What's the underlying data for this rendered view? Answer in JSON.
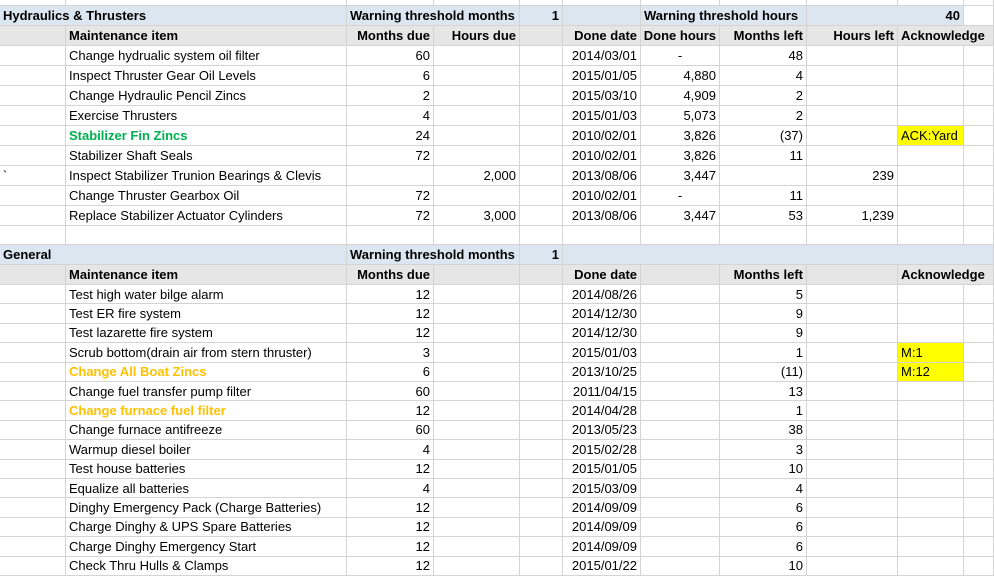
{
  "sections": [
    {
      "title": "Hydraulics & Thrusters",
      "params": [
        {
          "label": "Warning threshold months",
          "value": "1"
        },
        {
          "label": "Warning threshold hours",
          "value": "40"
        }
      ],
      "headers": {
        "item": "Maintenance item",
        "months_due": "Months due",
        "hours_due": "Hours due",
        "done_date": "Done date",
        "done_hours": "Done hours",
        "months_left": "Months left",
        "hours_left": "Hours left",
        "ack": "Acknowledge"
      },
      "rows": [
        {
          "marker": "",
          "item": "Change hydrualic system oil filter",
          "months_due": "60",
          "hours_due": "",
          "done_date": "2014/03/01",
          "done_hours": "-",
          "months_left": "48",
          "hours_left": "",
          "ack": "",
          "style": ""
        },
        {
          "marker": "",
          "item": "Inspect Thruster Gear Oil Levels",
          "months_due": "6",
          "hours_due": "",
          "done_date": "2015/01/05",
          "done_hours": "4,880",
          "months_left": "4",
          "hours_left": "",
          "ack": "",
          "style": ""
        },
        {
          "marker": "",
          "item": "Change Hydraulic Pencil Zincs",
          "months_due": "2",
          "hours_due": "",
          "done_date": "2015/03/10",
          "done_hours": "4,909",
          "months_left": "2",
          "hours_left": "",
          "ack": "",
          "style": ""
        },
        {
          "marker": "",
          "item": "Exercise Thrusters",
          "months_due": "4",
          "hours_due": "",
          "done_date": "2015/01/03",
          "done_hours": "5,073",
          "months_left": "2",
          "hours_left": "",
          "ack": "",
          "style": ""
        },
        {
          "marker": "",
          "item": "Stabilizer Fin Zincs",
          "months_due": "24",
          "hours_due": "",
          "done_date": "2010/02/01",
          "done_hours": "3,826",
          "months_left": "(37)",
          "hours_left": "",
          "ack": "ACK:Yard",
          "style": "green"
        },
        {
          "marker": "",
          "item": "Stabilizer Shaft Seals",
          "months_due": "72",
          "hours_due": "",
          "done_date": "2010/02/01",
          "done_hours": "3,826",
          "months_left": "11",
          "hours_left": "",
          "ack": "",
          "style": ""
        },
        {
          "marker": "`",
          "item": "Inspect Stabilizer Trunion Bearings & Clevis",
          "months_due": "",
          "hours_due": "2,000",
          "done_date": "2013/08/06",
          "done_hours": "3,447",
          "months_left": "",
          "hours_left": "239",
          "ack": "",
          "style": ""
        },
        {
          "marker": "",
          "item": "Change Thruster Gearbox Oil",
          "months_due": "72",
          "hours_due": "",
          "done_date": "2010/02/01",
          "done_hours": "-",
          "months_left": "11",
          "hours_left": "",
          "ack": "",
          "style": ""
        },
        {
          "marker": "",
          "item": "Replace Stabilizer Actuator Cylinders",
          "months_due": "72",
          "hours_due": "3,000",
          "done_date": "2013/08/06",
          "done_hours": "3,447",
          "months_left": "53",
          "hours_left": "1,239",
          "ack": "",
          "style": ""
        }
      ]
    },
    {
      "title": "General",
      "params": [
        {
          "label": "Warning threshold months",
          "value": "1"
        }
      ],
      "headers": {
        "item": "Maintenance item",
        "months_due": "Months due",
        "hours_due": "",
        "done_date": "Done date",
        "done_hours": "",
        "months_left": "Months left",
        "hours_left": "",
        "ack": "Acknowledge"
      },
      "rows": [
        {
          "marker": "",
          "item": "Test high water bilge alarm",
          "months_due": "12",
          "hours_due": "",
          "done_date": "2014/08/26",
          "done_hours": "",
          "months_left": "5",
          "hours_left": "",
          "ack": "",
          "style": ""
        },
        {
          "marker": "",
          "item": "Test ER fire system",
          "months_due": "12",
          "hours_due": "",
          "done_date": "2014/12/30",
          "done_hours": "",
          "months_left": "9",
          "hours_left": "",
          "ack": "",
          "style": ""
        },
        {
          "marker": "",
          "item": "Test lazarette fire system",
          "months_due": "12",
          "hours_due": "",
          "done_date": "2014/12/30",
          "done_hours": "",
          "months_left": "9",
          "hours_left": "",
          "ack": "",
          "style": ""
        },
        {
          "marker": "",
          "item": "Scrub bottom(drain air from stern thruster)",
          "months_due": "3",
          "hours_due": "",
          "done_date": "2015/01/03",
          "done_hours": "",
          "months_left": "1",
          "hours_left": "",
          "ack": "M:1",
          "style": ""
        },
        {
          "marker": "",
          "item": "Change All Boat Zincs",
          "months_due": "6",
          "hours_due": "",
          "done_date": "2013/10/25",
          "done_hours": "",
          "months_left": "(11)",
          "hours_left": "",
          "ack": "M:12",
          "style": "orange"
        },
        {
          "marker": "",
          "item": "Change fuel transfer pump filter",
          "months_due": "60",
          "hours_due": "",
          "done_date": "2011/04/15",
          "done_hours": "",
          "months_left": "13",
          "hours_left": "",
          "ack": "",
          "style": ""
        },
        {
          "marker": "",
          "item": "Change furnace fuel filter",
          "months_due": "12",
          "hours_due": "",
          "done_date": "2014/04/28",
          "done_hours": "",
          "months_left": "1",
          "hours_left": "",
          "ack": "",
          "style": "orange"
        },
        {
          "marker": "",
          "item": "Change furnace antifreeze",
          "months_due": "60",
          "hours_due": "",
          "done_date": "2013/05/23",
          "done_hours": "",
          "months_left": "38",
          "hours_left": "",
          "ack": "",
          "style": ""
        },
        {
          "marker": "",
          "item": "Warmup diesel boiler",
          "months_due": "4",
          "hours_due": "",
          "done_date": "2015/02/28",
          "done_hours": "",
          "months_left": "3",
          "hours_left": "",
          "ack": "",
          "style": ""
        },
        {
          "marker": "",
          "item": "Test house batteries",
          "months_due": "12",
          "hours_due": "",
          "done_date": "2015/01/05",
          "done_hours": "",
          "months_left": "10",
          "hours_left": "",
          "ack": "",
          "style": ""
        },
        {
          "marker": "",
          "item": "Equalize all batteries",
          "months_due": "4",
          "hours_due": "",
          "done_date": "2015/03/09",
          "done_hours": "",
          "months_left": "4",
          "hours_left": "",
          "ack": "",
          "style": ""
        },
        {
          "marker": "",
          "item": "Dinghy Emergency Pack (Charge Batteries)",
          "months_due": "12",
          "hours_due": "",
          "done_date": "2014/09/09",
          "done_hours": "",
          "months_left": "6",
          "hours_left": "",
          "ack": "",
          "style": ""
        },
        {
          "marker": "",
          "item": "Charge Dinghy & UPS Spare Batteries",
          "months_due": "12",
          "hours_due": "",
          "done_date": "2014/09/09",
          "done_hours": "",
          "months_left": "6",
          "hours_left": "",
          "ack": "",
          "style": ""
        },
        {
          "marker": "",
          "item": "Charge Dinghy Emergency Start",
          "months_due": "12",
          "hours_due": "",
          "done_date": "2014/09/09",
          "done_hours": "",
          "months_left": "6",
          "hours_left": "",
          "ack": "",
          "style": ""
        },
        {
          "marker": "",
          "item": "Check Thru Hulls & Clamps",
          "months_due": "12",
          "hours_due": "",
          "done_date": "2015/01/22",
          "done_hours": "",
          "months_left": "10",
          "hours_left": "",
          "ack": "",
          "style": ""
        }
      ]
    }
  ],
  "colors": {
    "section_header_bg": "#dce6f1",
    "column_header_bg": "#e7e6e6",
    "ack_highlight": "#ffff00",
    "overdue_text": "#00b050",
    "warning_text": "#ffc000",
    "gridline": "#d4d4d4"
  }
}
